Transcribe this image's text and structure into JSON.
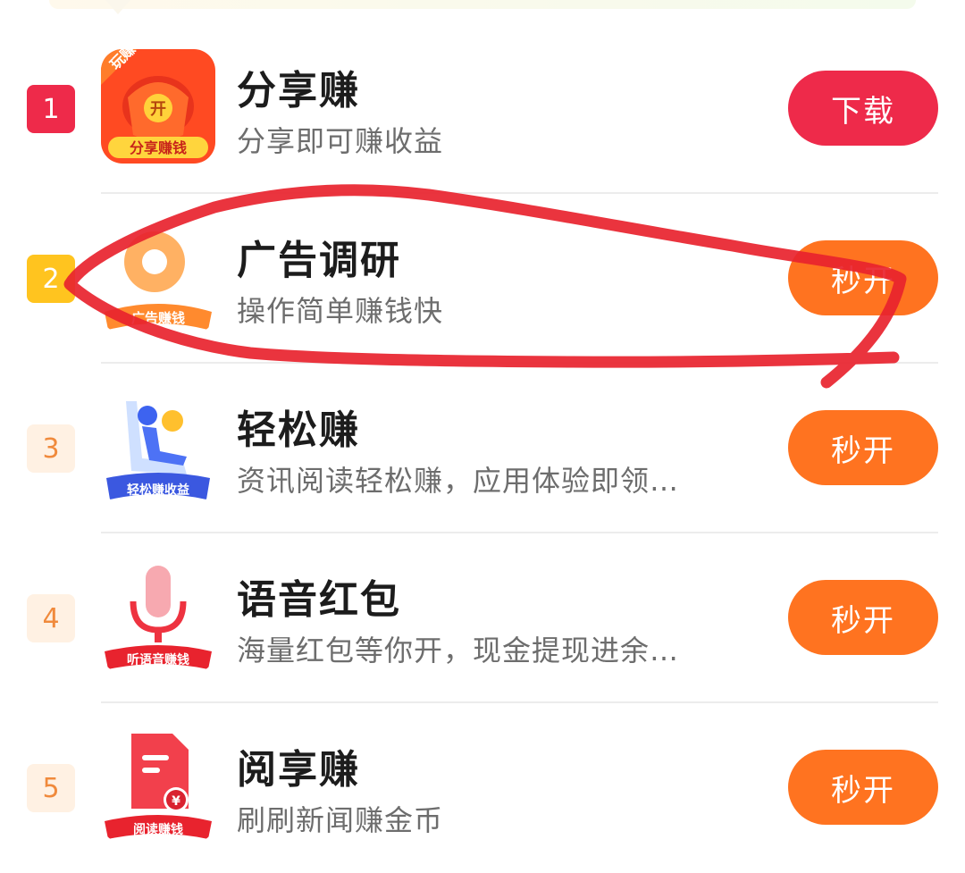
{
  "items": [
    {
      "rank": "1",
      "title": "分享赚",
      "subtitle": "分享即可赚收益",
      "button": "下载",
      "icon_name": "share-earn-icon",
      "icon_label": "分享赚钱",
      "icon_badge": "玩赚",
      "icon_coin": "开"
    },
    {
      "rank": "2",
      "title": "广告调研",
      "subtitle": "操作简单赚钱快",
      "button": "秒开",
      "icon_name": "ad-survey-icon",
      "icon_label": "广告赚钱"
    },
    {
      "rank": "3",
      "title": "轻松赚",
      "subtitle": "资讯阅读轻松赚，应用体验即领…",
      "button": "秒开",
      "icon_name": "easy-earn-icon",
      "icon_label": "轻松赚收益"
    },
    {
      "rank": "4",
      "title": "语音红包",
      "subtitle": "海量红包等你开，现金提现进余…",
      "button": "秒开",
      "icon_name": "microphone-icon",
      "icon_label": "听语音赚钱"
    },
    {
      "rank": "5",
      "title": "阅享赚",
      "subtitle": "刷刷新闻赚金币",
      "button": "秒开",
      "icon_name": "document-yen-icon",
      "icon_label": "阅读赚钱",
      "icon_coin": "¥"
    }
  ],
  "colors": {
    "download_button": "#ee2a4a",
    "open_button": "#ff7320",
    "rank1": "#ee2a4a",
    "rank2": "#ffc41f",
    "rank_other_text": "#f08a3c",
    "annotation": "#e8232e"
  }
}
